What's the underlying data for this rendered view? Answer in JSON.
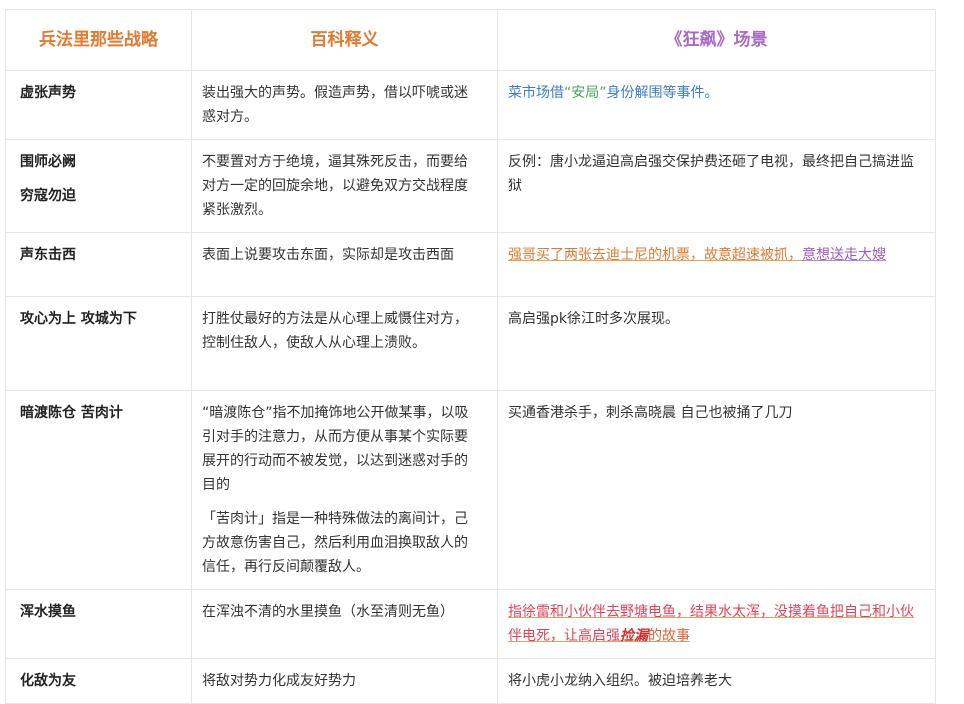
{
  "headers": [
    "兵法里那些战略",
    "百科释义",
    "《狂飙》场景"
  ],
  "rows": [
    {
      "name": "虚张声势",
      "def": "装出强大的声势。假造声势，借以吓唬或迷惑对方。",
      "scene_a": "菜市场借",
      "scene_b": "“安局”",
      "scene_c": "身份解围等事件。"
    },
    {
      "name": "围师必阙",
      "name2": "穷寇勿迫",
      "def": "不要置对方于绝境，逼其殊死反击，而要给对方一定的回旋余地，以避免双方交战程度紧张激烈。",
      "scene": "反例：唐小龙逼迫高启强交保护费还砸了电视，最终把自己搞进监狱"
    },
    {
      "name": "声东击西",
      "def": "表面上说要攻击东面，实际却是攻击西面",
      "scene_a": "强哥买了两张去迪士尼的机票，故意超速被抓，",
      "scene_b": "意想送走大嫂"
    },
    {
      "name": "攻心为上 攻城为下",
      "def": "打胜仗最好的方法是从心理上威慑住对方，控制住敌人，使敌人从心理上溃败。",
      "scene": "高启强pk徐江时多次展现。"
    },
    {
      "name": "暗渡陈仓  苦肉计",
      "def": "“暗渡陈仓”指不加掩饰地公开做某事，以吸引对手的注意力，从而方便从事某个实际要展开的行动而不被发觉，以达到迷惑对手的目的",
      "def2": "「苦肉计」指是一种特殊做法的离间计，己方故意伤害自己，然后利用血泪换取敌人的信任，再行反间颠覆敌人。",
      "scene": "买通香港杀手，刺杀高晓晨  自己也被捅了几刀"
    },
    {
      "name": "浑水摸鱼",
      "def": "在浑浊不清的水里摸鱼（水至清则无鱼）",
      "scene_a": "指徐雷和小伙伴去野塘电鱼，结果水太浑，没摸着鱼把自己",
      "scene_b": "和小伙伴电死，让高启强",
      "scene_c": "捡漏",
      "scene_d": "的故事"
    },
    {
      "name": "化敌为友",
      "def": "将敌对势力化成友好势力",
      "scene": "将小虎小龙纳入组织。被迫培养老大"
    }
  ],
  "colors": {
    "header_orange": "#e07b30",
    "header_purple": "#a96bc7",
    "link_blue": "#3a7dc9",
    "highlight_red": "#d03030"
  }
}
